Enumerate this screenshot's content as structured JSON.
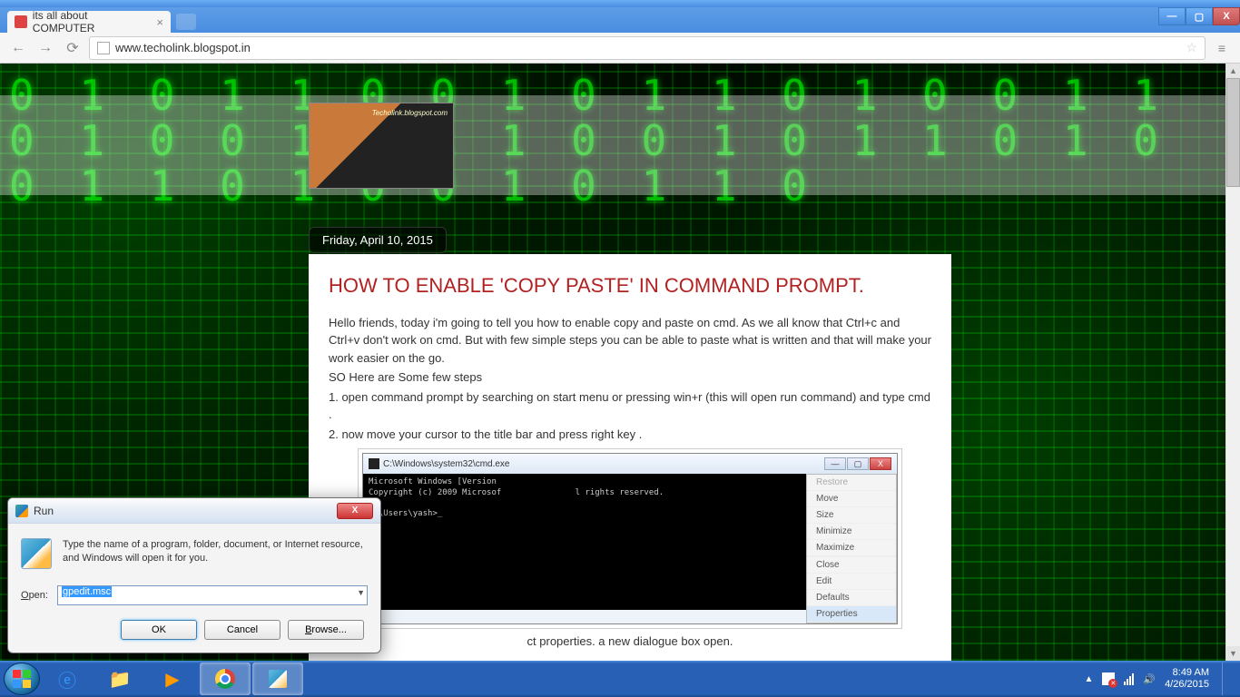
{
  "window": {
    "min": "—",
    "max": "▢",
    "close": "X"
  },
  "browser": {
    "tab_title": "its all about COMPUTER",
    "url": "www.techolink.blogspot.in",
    "menu_glyph": "≡"
  },
  "page": {
    "banner_caption": "Techolink.blogspot.com",
    "post_date": "Friday, April 10, 2015",
    "post_title": "HOW TO ENABLE 'COPY PASTE' IN COMMAND PROMPT.",
    "intro": "Hello friends, today i'm going to tell you how to enable copy and paste on cmd. As we all know that Ctrl+c and Ctrl+v don't work on cmd. But with few simple steps you can be able to paste what is written and that will make your work easier on the go.",
    "line2": "SO Here are Some few steps",
    "step1": "1. open command prompt by searching on start menu or pressing win+r (this will open run command) and type cmd .",
    "step2": "2. now move your cursor to the title bar and press right key .",
    "step3_partial": "ct properties. a new dialogue box open."
  },
  "cmd": {
    "title": "C:\\Windows\\system32\\cmd.exe",
    "body": "Microsoft Windows [Version \nCopyright (c) 2009 Microsof               l rights reserved.\n\nC:\\Users\\yash>_",
    "menu": {
      "restore": "Restore",
      "move": "Move",
      "size": "Size",
      "minimize": "Minimize",
      "maximize": "Maximize",
      "close": "Close",
      "edit": "Edit",
      "defaults": "Defaults",
      "properties": "Properties"
    }
  },
  "run": {
    "title": "Run",
    "desc": "Type the name of a program, folder, document, or Internet resource, and Windows will open it for you.",
    "label": "Open:",
    "value": "gpedit.msc",
    "ok": "OK",
    "cancel": "Cancel",
    "browse": "Browse..."
  },
  "taskbar": {
    "time": "8:49 AM",
    "date": "4/26/2015"
  }
}
